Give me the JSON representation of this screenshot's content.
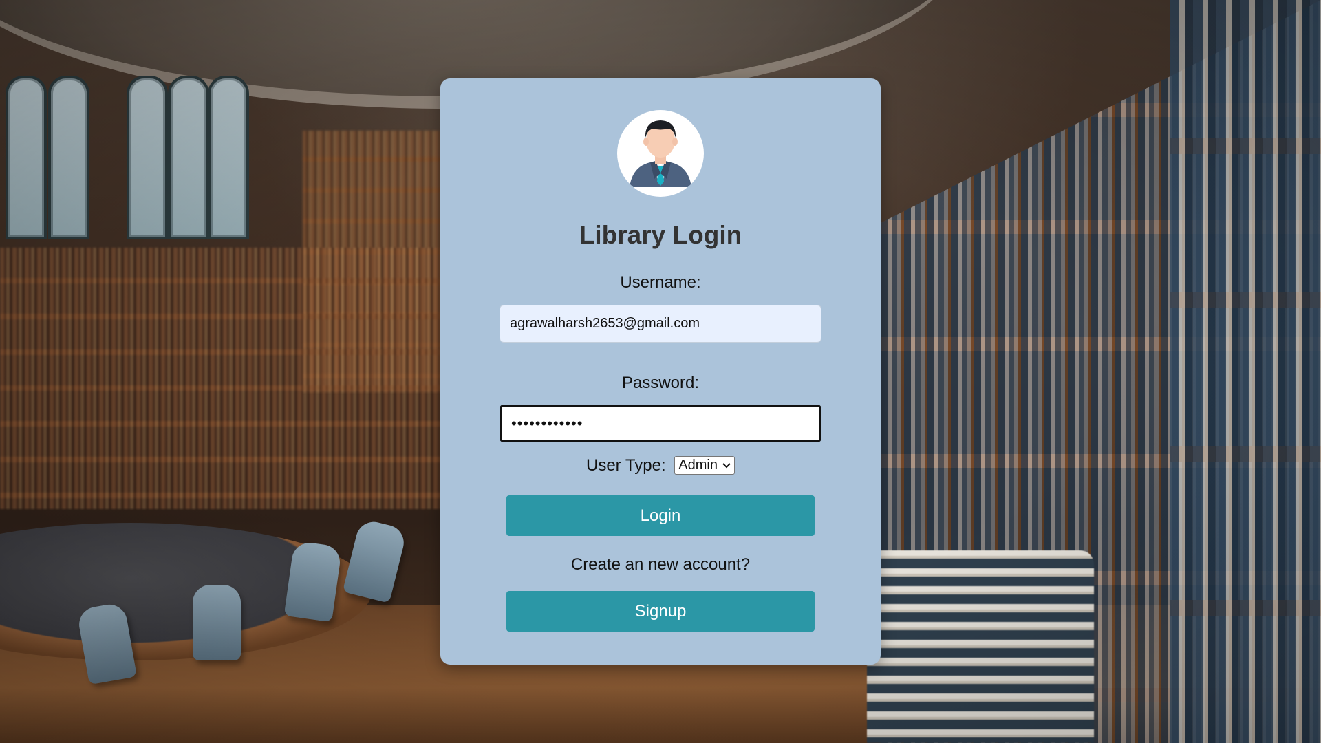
{
  "background": {
    "scene": "library-interior"
  },
  "login_card": {
    "title": "Library Login",
    "avatar_icon": "user-avatar-icon",
    "username": {
      "label": "Username:",
      "value": "agrawalharsh2653@gmail.com"
    },
    "password": {
      "label": "Password:",
      "masked_value": "••••••••••••"
    },
    "user_type": {
      "label": "User Type:",
      "selected": "Admin"
    },
    "login_button": "Login",
    "create_account_text": "Create an new account?",
    "signup_button": "Signup"
  },
  "colors": {
    "card_background": "#abc3da",
    "button": "#2b97a6",
    "button_text": "#ffffff",
    "title_text": "#333333",
    "autofill_input": "#e8f0fe"
  }
}
